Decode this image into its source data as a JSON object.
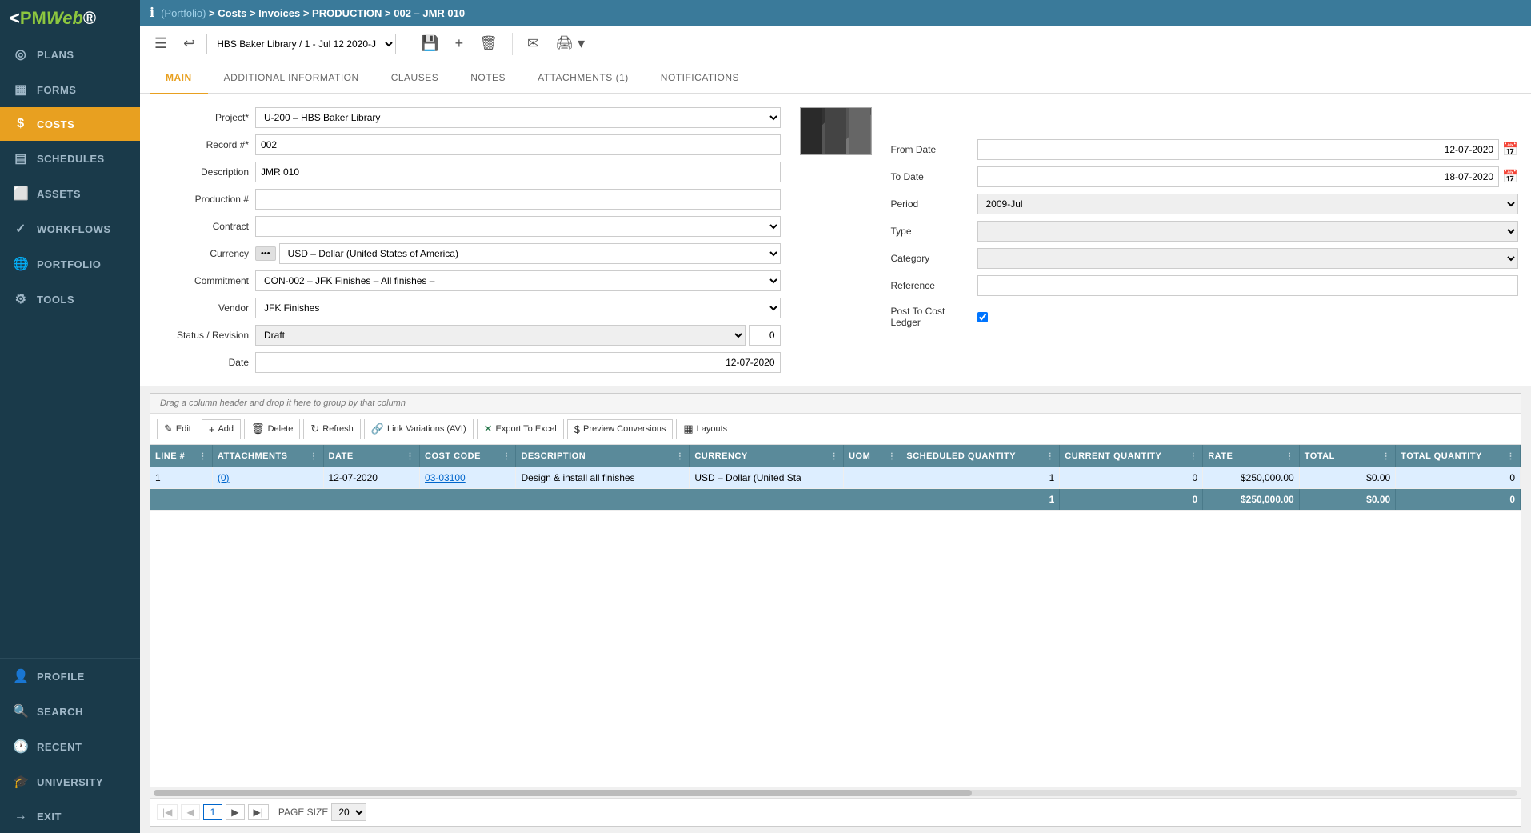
{
  "sidebar": {
    "logo": "PMWeb",
    "items": [
      {
        "id": "plans",
        "label": "PLANS",
        "icon": "◎"
      },
      {
        "id": "forms",
        "label": "FORMS",
        "icon": "▦"
      },
      {
        "id": "costs",
        "label": "COSTS",
        "icon": "$",
        "active": true
      },
      {
        "id": "schedules",
        "label": "SCHEDULES",
        "icon": "▤"
      },
      {
        "id": "assets",
        "label": "ASSETS",
        "icon": "⬜"
      },
      {
        "id": "workflows",
        "label": "WORKFLOWS",
        "icon": "✓"
      },
      {
        "id": "portfolio",
        "label": "PORTFOLIO",
        "icon": "🌐"
      },
      {
        "id": "tools",
        "label": "TOOLS",
        "icon": "⚙"
      }
    ],
    "bottom_items": [
      {
        "id": "profile",
        "label": "PROFILE",
        "icon": "👤"
      },
      {
        "id": "search",
        "label": "SEARCH",
        "icon": "🔍"
      },
      {
        "id": "recent",
        "label": "RECENT",
        "icon": "🕐"
      },
      {
        "id": "university",
        "label": "UNIVERSITY",
        "icon": "🎓"
      },
      {
        "id": "exit",
        "label": "EXIT",
        "icon": "→"
      }
    ]
  },
  "breadcrumb": {
    "portfolio_label": "(Portfolio)",
    "path": " > Costs > Invoices > PRODUCTION > 002 – JMR 010"
  },
  "toolbar": {
    "record_selector": "HBS Baker Library / 1 - Jul 12 2020-J",
    "save_icon": "💾",
    "add_icon": "+",
    "delete_icon": "🗑",
    "email_icon": "✉",
    "print_icon": "🖨"
  },
  "tabs": [
    {
      "id": "main",
      "label": "MAIN",
      "active": true
    },
    {
      "id": "additional",
      "label": "ADDITIONAL INFORMATION"
    },
    {
      "id": "clauses",
      "label": "CLAUSES"
    },
    {
      "id": "notes",
      "label": "NOTES"
    },
    {
      "id": "attachments",
      "label": "ATTACHMENTS (1)"
    },
    {
      "id": "notifications",
      "label": "NOTIFICATIONS"
    }
  ],
  "form": {
    "left": {
      "project_label": "Project*",
      "project_value": "U-200 – HBS Baker Library",
      "record_label": "Record #*",
      "record_value": "002",
      "description_label": "Description",
      "description_value": "JMR 010",
      "production_label": "Production #",
      "production_value": "",
      "contract_label": "Contract",
      "contract_value": "",
      "currency_label": "Currency",
      "currency_value": "USD – Dollar (United States of America)",
      "commitment_label": "Commitment",
      "commitment_value": "CON-002 – JFK Finishes – All finishes –",
      "vendor_label": "Vendor",
      "vendor_value": "JFK Finishes",
      "status_label": "Status / Revision",
      "status_value": "Draft",
      "status_num": "0",
      "date_label": "Date",
      "date_value": "12-07-2020"
    },
    "right": {
      "from_date_label": "From Date",
      "from_date_value": "12-07-2020",
      "to_date_label": "To Date",
      "to_date_value": "18-07-2020",
      "period_label": "Period",
      "period_value": "2009-Jul",
      "type_label": "Type",
      "type_value": "",
      "category_label": "Category",
      "category_value": "",
      "reference_label": "Reference",
      "reference_value": "",
      "post_label": "Post To Cost Ledger"
    }
  },
  "table": {
    "drag_hint": "Drag a column header and drop it here to group by that column",
    "toolbar": {
      "edit": "Edit",
      "add": "Add",
      "delete": "Delete",
      "refresh": "Refresh",
      "link_variations": "Link Variations (AVI)",
      "export_excel": "Export To Excel",
      "preview_conversions": "Preview Conversions",
      "layouts": "Layouts"
    },
    "columns": [
      {
        "id": "line",
        "label": "LINE #"
      },
      {
        "id": "attachments",
        "label": "ATTACHMENTS"
      },
      {
        "id": "date",
        "label": "DATE"
      },
      {
        "id": "cost_code",
        "label": "COST CODE"
      },
      {
        "id": "description",
        "label": "DESCRIPTION"
      },
      {
        "id": "currency",
        "label": "CURRENCY"
      },
      {
        "id": "uom",
        "label": "UOM"
      },
      {
        "id": "scheduled_qty",
        "label": "SCHEDULED QUANTITY"
      },
      {
        "id": "current_qty",
        "label": "CURRENT QUANTITY"
      },
      {
        "id": "rate",
        "label": "RATE"
      },
      {
        "id": "total",
        "label": "TOTAL"
      },
      {
        "id": "total_qty",
        "label": "TOTAL QUANTITY"
      }
    ],
    "rows": [
      {
        "line": "1",
        "attachments": "(0)",
        "date": "12-07-2020",
        "cost_code": "03-03100",
        "description": "Design & install all finishes",
        "currency": "USD – Dollar (United Sta",
        "uom": "",
        "scheduled_qty": "1",
        "current_qty": "0",
        "rate": "$250,000.00",
        "total": "$0.00",
        "total_qty": "0"
      }
    ],
    "totals": {
      "scheduled_qty": "1",
      "current_qty": "0",
      "rate": "$250,000.00",
      "total": "$0.00",
      "total_qty": "0"
    },
    "pagination": {
      "current_page": "1",
      "page_size": "20",
      "page_size_label": "PAGE SIZE"
    }
  }
}
